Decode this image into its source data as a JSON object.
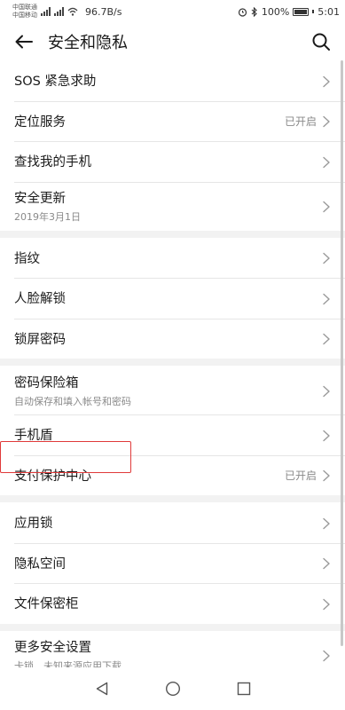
{
  "status_bar": {
    "carrier1": "中国联通",
    "carrier2": "中国移动",
    "net_speed": "96.7B/s",
    "battery": "100%",
    "time": "5:01"
  },
  "header": {
    "title": "安全和隐私"
  },
  "groups": [
    {
      "items": [
        {
          "title": "SOS 紧急求助"
        },
        {
          "title": "定位服务",
          "value": "已开启"
        },
        {
          "title": "查找我的手机"
        },
        {
          "title": "安全更新",
          "subtitle": "2019年3月1日"
        }
      ]
    },
    {
      "items": [
        {
          "title": "指纹"
        },
        {
          "title": "人脸解锁"
        },
        {
          "title": "锁屏密码"
        }
      ]
    },
    {
      "items": [
        {
          "title": "密码保险箱",
          "subtitle": "自动保存和填入帐号和密码"
        },
        {
          "title": "手机盾"
        },
        {
          "title": "支付保护中心",
          "value": "已开启"
        }
      ]
    },
    {
      "items": [
        {
          "title": "应用锁"
        },
        {
          "title": "隐私空间"
        },
        {
          "title": "文件保密柜"
        }
      ]
    },
    {
      "items": [
        {
          "title": "更多安全设置",
          "subtitle": "卡锁、未知来源应用下载"
        }
      ]
    }
  ],
  "icons": {
    "back": "arrow-left-icon",
    "search": "search-icon",
    "chevron": "chevron-right-icon",
    "nav_back": "triangle-back-icon",
    "nav_home": "circle-home-icon",
    "nav_recent": "square-recent-icon"
  },
  "colors": {
    "highlight": "#e03a3a",
    "secondary_text": "#8a8a8a"
  }
}
